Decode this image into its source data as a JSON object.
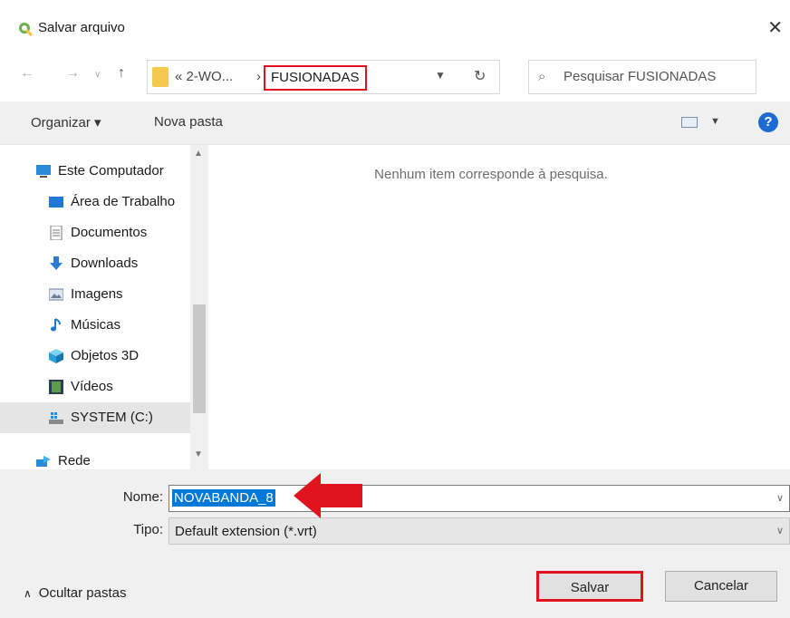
{
  "window": {
    "title": "Salvar arquivo"
  },
  "address": {
    "prev_crumb": "« 2-WO...",
    "separator": "›",
    "current_folder": "FUSIONADAS"
  },
  "search": {
    "placeholder": "Pesquisar FUSIONADAS"
  },
  "toolbar": {
    "organize": "Organizar ▾",
    "new_folder": "Nova pasta",
    "help": "?"
  },
  "nav": {
    "items": [
      {
        "label": "Este Computador",
        "icon": "computer-icon"
      },
      {
        "label": "Área de Trabalho",
        "icon": "desktop-icon"
      },
      {
        "label": "Documentos",
        "icon": "documents-icon"
      },
      {
        "label": "Downloads",
        "icon": "downloads-icon"
      },
      {
        "label": "Imagens",
        "icon": "pictures-icon"
      },
      {
        "label": "Músicas",
        "icon": "music-icon"
      },
      {
        "label": "Objetos 3D",
        "icon": "3d-objects-icon"
      },
      {
        "label": "Vídeos",
        "icon": "videos-icon"
      },
      {
        "label": "SYSTEM (C:)",
        "icon": "drive-icon"
      },
      {
        "label": "Rede",
        "icon": "network-icon"
      }
    ]
  },
  "content": {
    "empty_message": "Nenhum item corresponde à pesquisa."
  },
  "form": {
    "name_label": "Nome:",
    "name_value": "NOVABANDA_8",
    "type_label": "Tipo:",
    "type_value": "Default extension (*.vrt)"
  },
  "footer": {
    "hide_folders": "Ocultar pastas",
    "save": "Salvar",
    "cancel": "Cancelar"
  },
  "colors": {
    "highlight": "#e0141e",
    "selection": "#0078d7"
  }
}
